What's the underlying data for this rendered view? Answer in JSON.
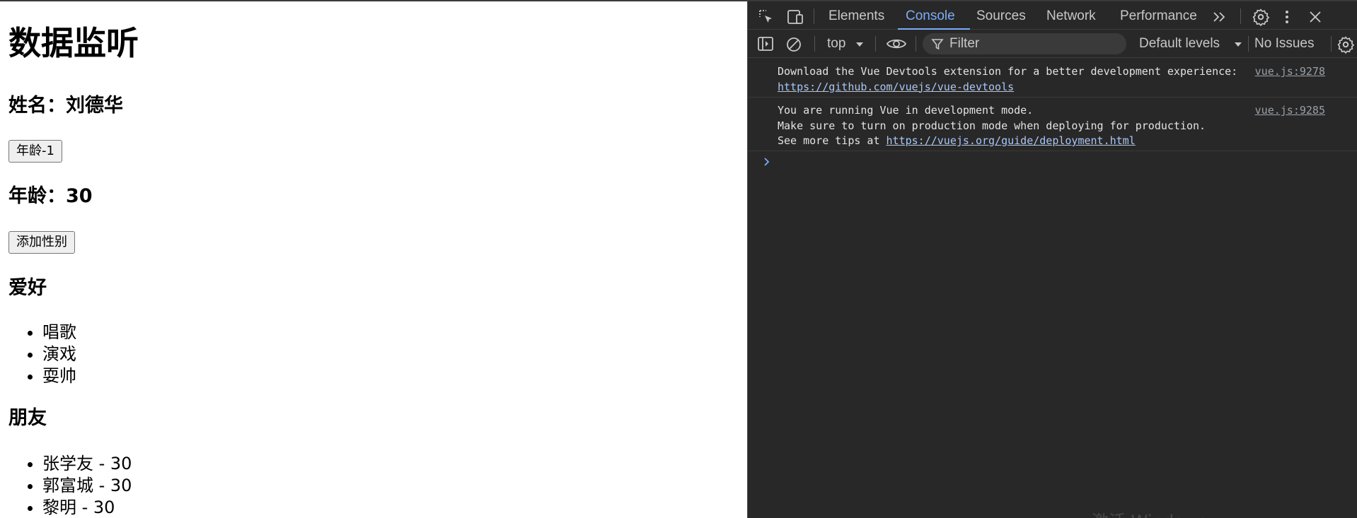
{
  "page": {
    "title": "数据监听",
    "name_line": "姓名：刘德华",
    "age_minus_button": "年龄-1",
    "age_line": "年龄：30",
    "add_gender_button": "添加性别",
    "hobbies_heading": "爱好",
    "hobbies": [
      "唱歌",
      "演戏",
      "耍帅"
    ],
    "friends_heading": "朋友",
    "friends": [
      "张学友 - 30",
      "郭富城 - 30",
      "黎明 - 30"
    ]
  },
  "devtools": {
    "tabs": [
      "Elements",
      "Console",
      "Sources",
      "Network",
      "Performance"
    ],
    "active_tab": "Console",
    "toolbar": {
      "context": "top",
      "filter_placeholder": "Filter",
      "levels": "Default levels",
      "issues": "No Issues"
    },
    "messages": [
      {
        "line1": "Download the Vue Devtools extension for a better development experience:",
        "link": "https://github.com/vuejs/vue-devtools",
        "source": "vue.js:9278"
      },
      {
        "line1": "You are running Vue in development mode.",
        "line2": "Make sure to turn on production mode when deploying for production.",
        "line3_prefix": "See more tips at ",
        "link": "https://vuejs.org/guide/deployment.html",
        "source": "vue.js:9285"
      }
    ],
    "watermark": "激活 Windows"
  },
  "colors": {
    "devtools_bg": "#282828",
    "active_tab": "#7cacf8",
    "link": "#a8c7fa"
  },
  "icons": [
    "inspect-element-icon",
    "device-toolbar-icon",
    "more-tabs-icon",
    "settings-gear-icon",
    "kebab-menu-icon",
    "close-icon",
    "sidebar-toggle-icon",
    "clear-console-icon",
    "dropdown-arrow-icon",
    "eye-icon",
    "filter-funnel-icon",
    "console-settings-gear-icon",
    "prompt-chevron-icon"
  ]
}
